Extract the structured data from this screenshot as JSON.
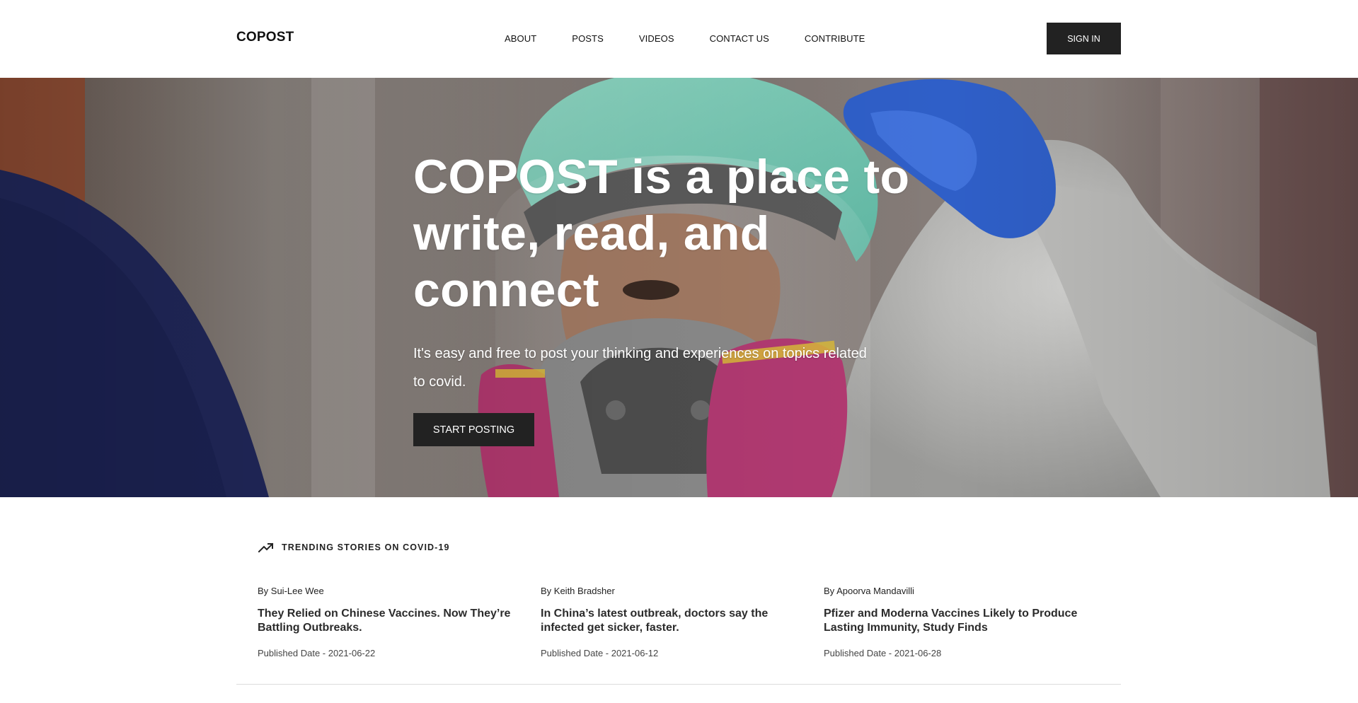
{
  "header": {
    "logo": "COPOST",
    "nav": [
      "ABOUT",
      "POSTS",
      "VIDEOS",
      "CONTACT US",
      "CONTRIBUTE"
    ],
    "sign_in": "SIGN IN"
  },
  "hero": {
    "title": "COPOST is a place to write, read, and connect",
    "subtitle": "It's easy and free to post your thinking and experiences on topics related to covid.",
    "cta": "START POSTING"
  },
  "trending": {
    "icon": "trending-up-icon",
    "title": "TRENDING STORIES ON COVID-19",
    "stories": [
      {
        "author": "By Sui-Lee Wee",
        "title": "They Relied on Chinese Vaccines. Now They’re Battling Outbreaks.",
        "date": "Published Date - 2021-06-22"
      },
      {
        "author": "By Keith Bradsher",
        "title": "In China’s latest outbreak, doctors say the infected get sicker, faster.",
        "date": "Published Date - 2021-06-12"
      },
      {
        "author": "By Apoorva Mandavilli",
        "title": "Pfizer and Moderna Vaccines Likely to Produce Lasting Immunity, Study Finds",
        "date": "Published Date - 2021-06-28"
      }
    ]
  }
}
